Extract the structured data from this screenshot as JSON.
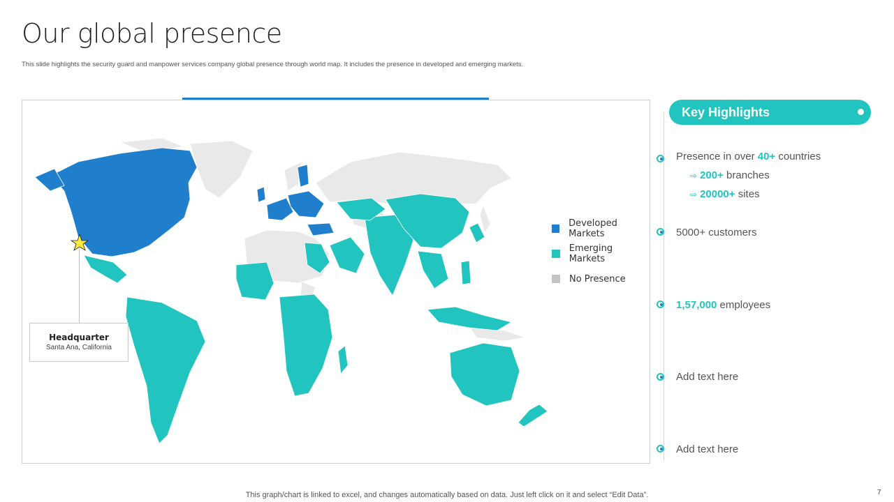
{
  "slide": {
    "title": "Our global presence",
    "subtitle": "This slide highlights the security guard and manpower services company global presence through world map. It includes the presence in developed and emerging markets.",
    "footer": "This graph/chart is linked to excel, and changes automatically based on data. Just left click on it and select “Edit Data”.",
    "page_number": "7"
  },
  "colors": {
    "developed": "#1f7fcd",
    "emerging": "#21c4bf",
    "no_presence": "#e6e6e6",
    "accent": "#21c4bf"
  },
  "legend": [
    {
      "label": "Developed Markets",
      "color": "#1f7fcd"
    },
    {
      "label": "Emerging Markets",
      "color": "#21c4bf"
    },
    {
      "label": "No Presence",
      "color": "#c4c4c4"
    }
  ],
  "headquarter": {
    "title": "Headquarter",
    "location": "Santa Ana, California",
    "marker_icon": "star-icon"
  },
  "key_highlights": {
    "title": "Key Highlights",
    "countries": {
      "prefix": "Presence in over ",
      "value": "40+",
      "suffix": " countries"
    },
    "branches": {
      "value": "200+",
      "suffix": " branches"
    },
    "sites": {
      "value": "20000+",
      "suffix": " sites"
    },
    "customers": {
      "text": "5000+ customers"
    },
    "employees": {
      "value": "1,57,000",
      "suffix": " employees"
    },
    "item4": {
      "text": "Add text here"
    },
    "item5": {
      "text": "Add text here"
    }
  }
}
